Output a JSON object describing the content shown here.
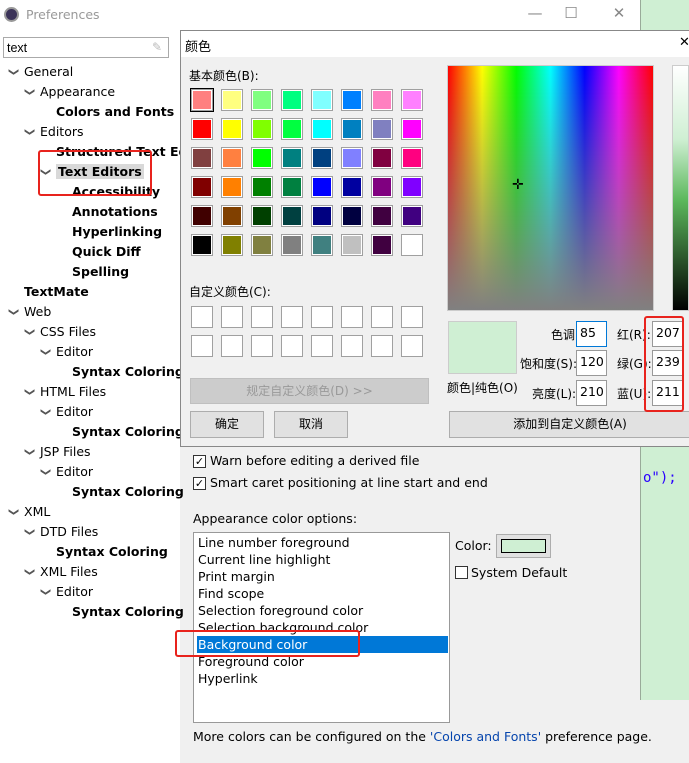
{
  "window": {
    "title": "Preferences",
    "minimize": "—",
    "maximize": "☐",
    "close": "✕"
  },
  "filter": {
    "value": "text"
  },
  "tree": [
    {
      "label": "General",
      "level": 0,
      "expanded": true
    },
    {
      "label": "Appearance",
      "level": 1,
      "expanded": true
    },
    {
      "label": "Colors and Fonts",
      "level": 2,
      "bold": true
    },
    {
      "label": "Editors",
      "level": 1,
      "expanded": true
    },
    {
      "label": "Structured Text Ed",
      "level": 2,
      "bold": true
    },
    {
      "label": "Text Editors",
      "level": 2,
      "bold": true,
      "expanded": true,
      "selected": true
    },
    {
      "label": "Accessibility",
      "level": 3,
      "bold": true
    },
    {
      "label": "Annotations",
      "level": 3,
      "bold": true
    },
    {
      "label": "Hyperlinking",
      "level": 3,
      "bold": true
    },
    {
      "label": "Quick Diff",
      "level": 3,
      "bold": true
    },
    {
      "label": "Spelling",
      "level": 3,
      "bold": true
    },
    {
      "label": "TextMate",
      "level": 0,
      "bold": true
    },
    {
      "label": "Web",
      "level": 0,
      "expanded": true
    },
    {
      "label": "CSS Files",
      "level": 1,
      "expanded": true
    },
    {
      "label": "Editor",
      "level": 2,
      "expanded": true
    },
    {
      "label": "Syntax Coloring",
      "level": 3,
      "bold": true
    },
    {
      "label": "HTML Files",
      "level": 1,
      "expanded": true
    },
    {
      "label": "Editor",
      "level": 2,
      "expanded": true
    },
    {
      "label": "Syntax Coloring",
      "level": 3,
      "bold": true
    },
    {
      "label": "JSP Files",
      "level": 1,
      "expanded": true
    },
    {
      "label": "Editor",
      "level": 2,
      "expanded": true
    },
    {
      "label": "Syntax Coloring",
      "level": 3,
      "bold": true
    },
    {
      "label": "XML",
      "level": 0,
      "expanded": true
    },
    {
      "label": "DTD Files",
      "level": 1,
      "expanded": true
    },
    {
      "label": "Syntax Coloring",
      "level": 2,
      "bold": true
    },
    {
      "label": "XML Files",
      "level": 1,
      "expanded": true
    },
    {
      "label": "Editor",
      "level": 2,
      "expanded": true
    },
    {
      "label": "Syntax Coloring",
      "level": 3,
      "bold": true
    }
  ],
  "color_dialog": {
    "title": "颜色",
    "close": "✕",
    "basic_label": "基本颜色(B):",
    "basic_colors": [
      "#ff8080",
      "#ffff80",
      "#80ff80",
      "#00ff80",
      "#80ffff",
      "#0080ff",
      "#ff80c0",
      "#ff80ff",
      "#ff0000",
      "#ffff00",
      "#80ff00",
      "#00ff40",
      "#00ffff",
      "#0080c0",
      "#8080c0",
      "#ff00ff",
      "#804040",
      "#ff8040",
      "#00ff00",
      "#008080",
      "#004080",
      "#8080ff",
      "#800040",
      "#ff0080",
      "#800000",
      "#ff8000",
      "#008000",
      "#008040",
      "#0000ff",
      "#0000a0",
      "#800080",
      "#8000ff",
      "#400000",
      "#804000",
      "#004000",
      "#004040",
      "#000080",
      "#000040",
      "#400040",
      "#400080",
      "#000000",
      "#808000",
      "#808040",
      "#808080",
      "#408080",
      "#c0c0c0",
      "#400040",
      "#ffffff"
    ],
    "custom_label": "自定义颜色(C):",
    "define_custom": "规定自定义颜色(D) >>",
    "ok": "确定",
    "cancel": "取消",
    "preview_label": "颜色|纯色(O)",
    "preview_color": "#cfefd3",
    "hue_label": "色调(E):",
    "hue": "85",
    "sat_label": "饱和度(S):",
    "sat": "120",
    "lum_label": "亮度(L):",
    "lum": "210",
    "red_label": "红(R):",
    "red": "207",
    "green_label": "绿(G):",
    "green": "239",
    "blue_label": "蓝(U):",
    "blue": "211",
    "add_custom": "添加到自定义颜色(A)"
  },
  "editor_snippet": "o\");",
  "prefs": {
    "warn_derived": "Warn before editing a derived file",
    "smart_caret": "Smart caret positioning at line start and end",
    "appearance_label": "Appearance color options:",
    "options": [
      "Line number foreground",
      "Current line highlight",
      "Print margin",
      "Find scope",
      "Selection foreground color",
      "Selection background color",
      "Background color",
      "Foreground color",
      "Hyperlink"
    ],
    "selected_option": "Background color",
    "color_label": "Color:",
    "color_value": "#cfefd3",
    "system_default": "System Default",
    "footer_pre": "More colors can be configured on the ",
    "footer_link": "'Colors and Fonts'",
    "footer_post": " preference page."
  }
}
